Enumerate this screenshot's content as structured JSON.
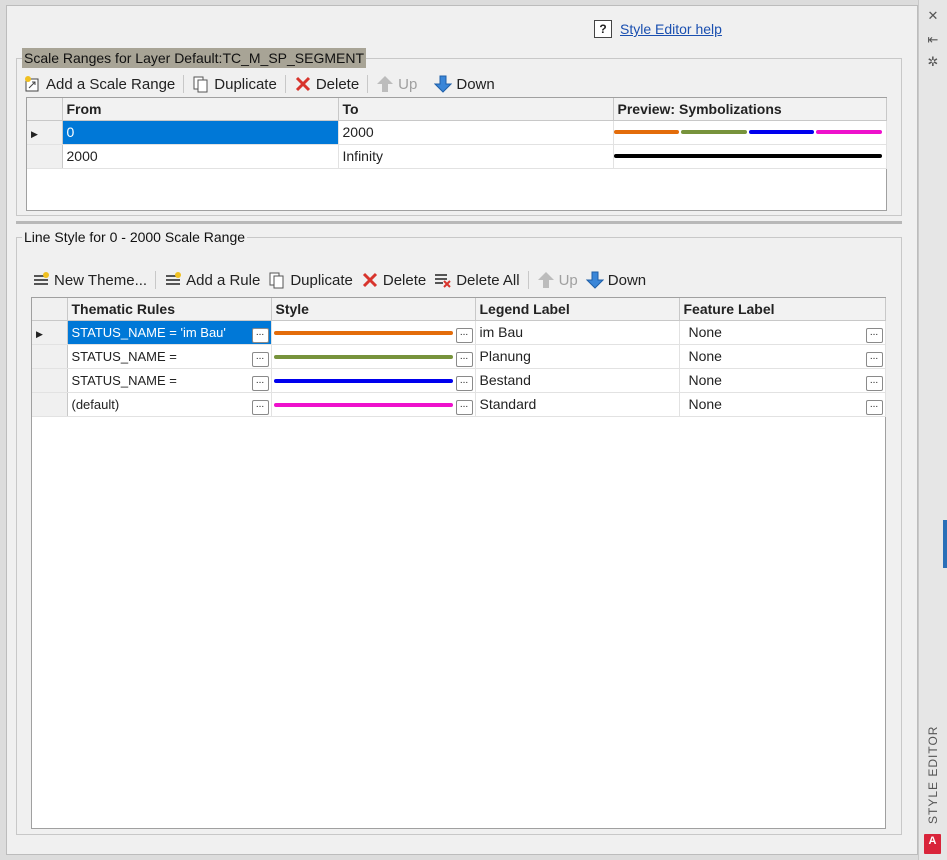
{
  "help": {
    "label": "Style Editor help",
    "icon": "help-icon"
  },
  "scale_section": {
    "title": "Scale Ranges for Layer Default:TC_M_SP_SEGMENT",
    "toolbar": {
      "add": "Add a Scale Range",
      "duplicate": "Duplicate",
      "delete": "Delete",
      "up": "Up",
      "down": "Down"
    },
    "columns": [
      "From",
      "To",
      "Preview: Symbolizations"
    ],
    "rows": [
      {
        "from": "0",
        "to": "2000",
        "preview": [
          "#e36c0a",
          "#77933c",
          "#0000ee",
          "#ee11cc"
        ]
      },
      {
        "from": "2000",
        "to": "Infinity",
        "preview": [
          "#000000"
        ]
      }
    ]
  },
  "line_section": {
    "title": "Line Style for 0 - 2000 Scale Range",
    "toolbar": {
      "new_theme": "New Theme...",
      "add_rule": "Add a Rule",
      "duplicate": "Duplicate",
      "delete": "Delete",
      "delete_all": "Delete All",
      "up": "Up",
      "down": "Down"
    },
    "columns": [
      "Thematic Rules",
      "Style",
      "Legend Label",
      "Feature Label"
    ],
    "rows": [
      {
        "rule": "STATUS_NAME  =  'im Bau'",
        "color": "#e36c0a",
        "legend": "im Bau",
        "feature": "None"
      },
      {
        "rule": "STATUS_NAME  =",
        "color": "#77933c",
        "legend": "Planung",
        "feature": "None"
      },
      {
        "rule": "STATUS_NAME  =",
        "color": "#0000ee",
        "legend": "Bestand",
        "feature": "None"
      },
      {
        "rule": "(default)",
        "color": "#ee11cc",
        "legend": "Standard",
        "feature": "None"
      }
    ]
  },
  "side_panel": {
    "title": "STYLE EDITOR",
    "logo": "A"
  },
  "button_ellipsis": "..."
}
